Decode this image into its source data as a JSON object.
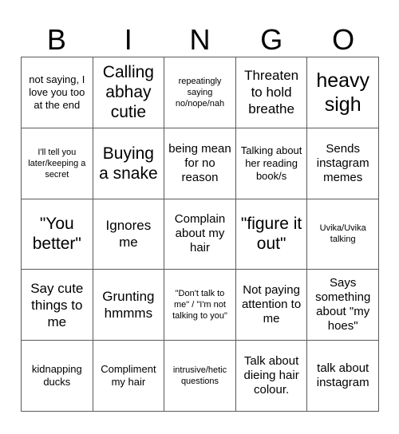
{
  "card": {
    "header_letters": [
      "B",
      "I",
      "N",
      "G",
      "O"
    ],
    "columns": 5,
    "rows": 5,
    "background_color": "#ffffff",
    "text_color": "#000000",
    "grid_line_color": "#5a5a5a",
    "cells": [
      {
        "text": "not saying, I love you too at the end",
        "size": "sm"
      },
      {
        "text": "Calling abhay cutie",
        "size": "xl"
      },
      {
        "text": "repeatingly saying no/nope/nah",
        "size": "xs"
      },
      {
        "text": "Threaten to hold breathe",
        "size": "lg"
      },
      {
        "text": "heavy sigh",
        "size": "xxl"
      },
      {
        "text": "I'll tell you later/keeping a secret",
        "size": "xs"
      },
      {
        "text": "Buying a snake",
        "size": "xl"
      },
      {
        "text": "being mean for no reason",
        "size": "md"
      },
      {
        "text": "Talking about her reading book/s",
        "size": "sm"
      },
      {
        "text": "Sends instagram memes",
        "size": "md"
      },
      {
        "text": "\"You better\"",
        "size": "xl"
      },
      {
        "text": "Ignores me",
        "size": "lg"
      },
      {
        "text": "Complain about my hair",
        "size": "md"
      },
      {
        "text": "\"figure it out\"",
        "size": "xl"
      },
      {
        "text": "Uvika/Uvika talking",
        "size": "xs"
      },
      {
        "text": "Say cute things to me",
        "size": "lg"
      },
      {
        "text": "Grunting hmmms",
        "size": "lg"
      },
      {
        "text": "\"Don't talk to me\" / \"I'm not talking to you\"",
        "size": "xs"
      },
      {
        "text": "Not paying attention to me",
        "size": "md"
      },
      {
        "text": "Says something about \"my hoes\"",
        "size": "md"
      },
      {
        "text": "kidnapping ducks",
        "size": "sm"
      },
      {
        "text": "Compliment my hair",
        "size": "sm"
      },
      {
        "text": "intrusive/hetic questions",
        "size": "xs"
      },
      {
        "text": "Talk about dieing hair colour.",
        "size": "md"
      },
      {
        "text": "talk about instagram",
        "size": "md"
      }
    ]
  }
}
